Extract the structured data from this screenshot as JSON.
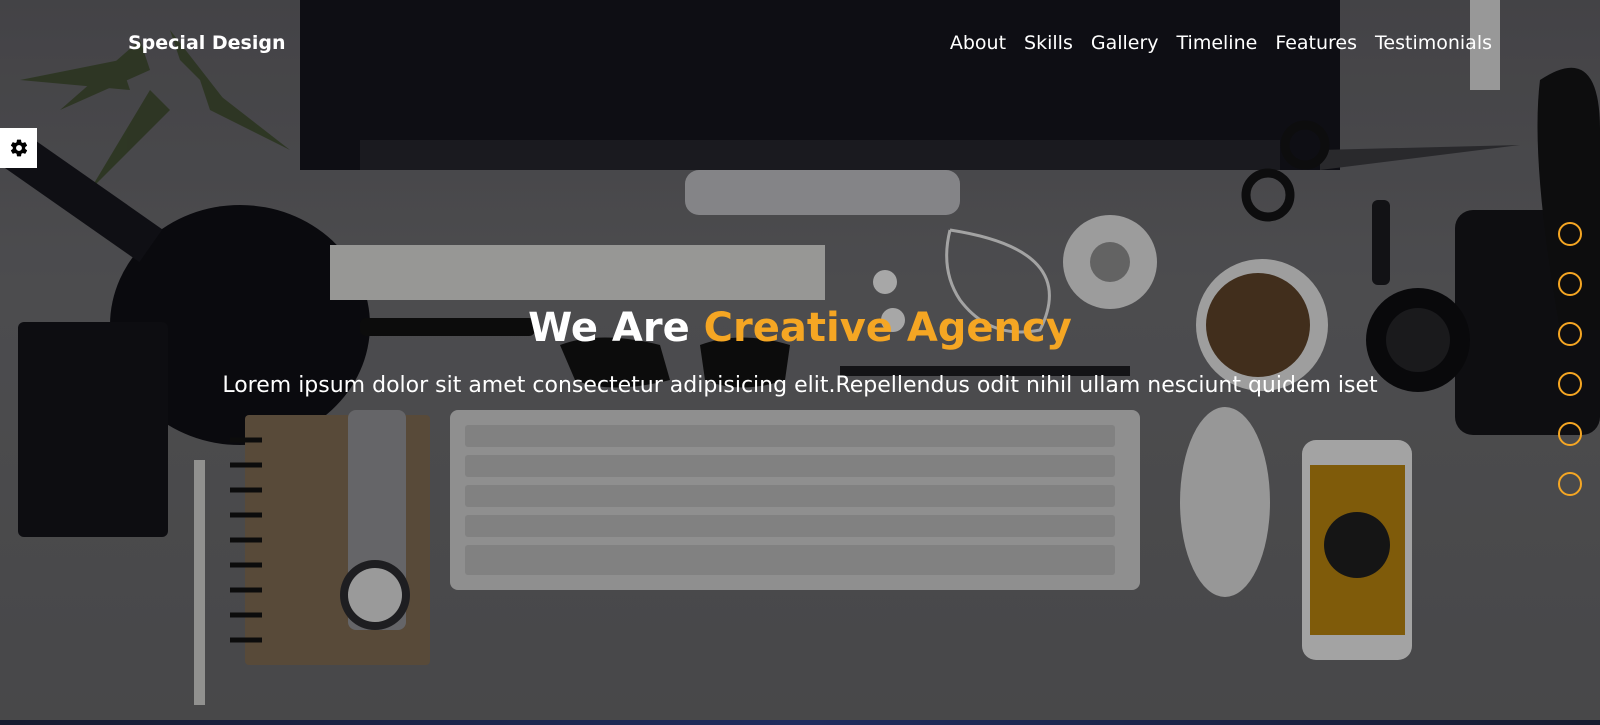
{
  "brand": {
    "logo_text": "Special Design"
  },
  "nav": {
    "items": [
      {
        "label": "About"
      },
      {
        "label": "Skills"
      },
      {
        "label": "Gallery"
      },
      {
        "label": "Timeline"
      },
      {
        "label": "Features"
      },
      {
        "label": "Testimonials"
      }
    ]
  },
  "hero": {
    "title_main": "We Are",
    "title_accent": "Creative Agency",
    "subtitle": "Lorem ipsum dolor sit amet consectetur adipisicing elit.Repellendus odit nihil ullam nesciunt quidem iset"
  },
  "bullets": [
    {
      "section": "About"
    },
    {
      "section": "Skills"
    },
    {
      "section": "Gallery"
    },
    {
      "section": "Timeline"
    },
    {
      "section": "Features"
    },
    {
      "section": "Testimonials"
    }
  ],
  "settings": {
    "icon": "gear-icon"
  },
  "colors": {
    "accent": "#f5a623",
    "text": "#ffffff",
    "overlay": "rgba(0,0,0,0.28)"
  }
}
